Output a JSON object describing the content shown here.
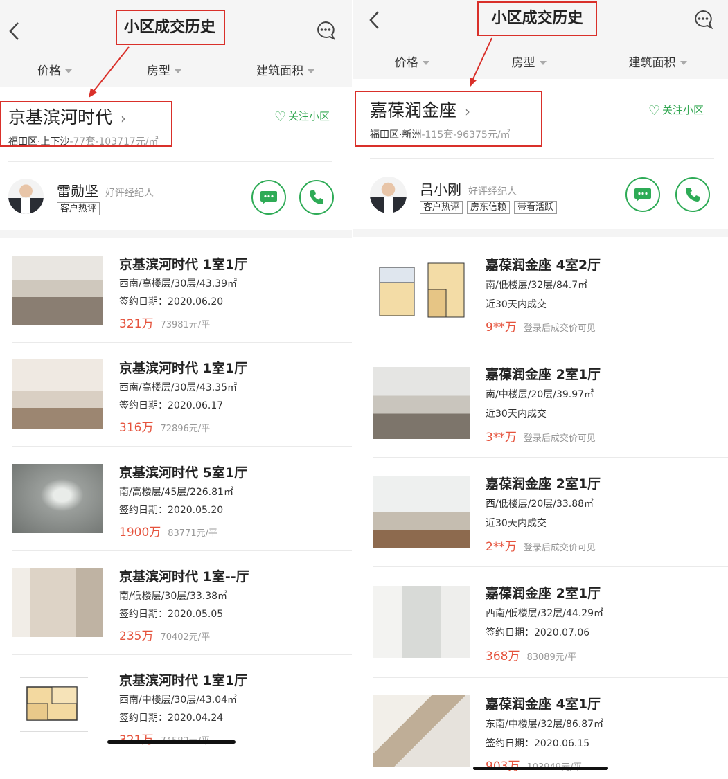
{
  "colors": {
    "accent_green": "#2eab56",
    "price_red": "#e5533d",
    "annotation_red": "#d9302a"
  },
  "panels": [
    {
      "header": {
        "title": "小区成交历史",
        "back_icon": "chevron-left-icon",
        "message_icon": "chat-bubble-icon"
      },
      "filters": [
        "价格",
        "房型",
        "建筑面积"
      ],
      "community": {
        "name": "京基滨河时代",
        "district": "福田区·上下沙",
        "stats": "-77套-103717元/㎡",
        "follow_label": "关注小区"
      },
      "agent": {
        "name": "雷勋坚",
        "role": "好评经纪人",
        "tags": [
          "客户热评"
        ]
      },
      "listings": [
        {
          "title": "京基滨河时代 1室1厅",
          "spec": "西南/高楼层/30层/43.39㎡",
          "date": "签约日期：2020.06.20",
          "price": "321万",
          "unit_price": "73981元/平"
        },
        {
          "title": "京基滨河时代 1室1厅",
          "spec": "西南/高楼层/30层/43.35㎡",
          "date": "签约日期：2020.06.17",
          "price": "316万",
          "unit_price": "72896元/平"
        },
        {
          "title": "京基滨河时代 5室1厅",
          "spec": "南/高楼层/45层/226.81㎡",
          "date": "签约日期：2020.05.20",
          "price": "1900万",
          "unit_price": "83771元/平"
        },
        {
          "title": "京基滨河时代 1室--厅",
          "spec": "南/低楼层/30层/33.38㎡",
          "date": "签约日期：2020.05.05",
          "price": "235万",
          "unit_price": "70402元/平"
        },
        {
          "title": "京基滨河时代 1室1厅",
          "spec": "西南/中楼层/30层/43.04㎡",
          "date": "签约日期：2020.04.24",
          "price": "321万",
          "unit_price": "74582元/平"
        }
      ]
    },
    {
      "header": {
        "title": "小区成交历史",
        "back_icon": "chevron-left-icon",
        "message_icon": "chat-bubble-icon"
      },
      "filters": [
        "价格",
        "房型",
        "建筑面积"
      ],
      "community": {
        "name": "嘉葆润金座",
        "district": "福田区·新洲",
        "stats": "-115套-96375元/㎡",
        "follow_label": "关注小区"
      },
      "agent": {
        "name": "吕小刚",
        "role": "好评经纪人",
        "tags": [
          "客户热评",
          "房东信赖",
          "带看活跃"
        ]
      },
      "listings": [
        {
          "title": "嘉葆润金座 4室2厅",
          "spec": "南/低楼层/32层/84.7㎡",
          "date": "近30天内成交",
          "price": "9**万",
          "unit_price": "登录后成交价可见"
        },
        {
          "title": "嘉葆润金座 2室1厅",
          "spec": "南/中楼层/20层/39.97㎡",
          "date": "近30天内成交",
          "price": "3**万",
          "unit_price": "登录后成交价可见"
        },
        {
          "title": "嘉葆润金座 2室1厅",
          "spec": "西/低楼层/20层/33.88㎡",
          "date": "近30天内成交",
          "price": "2**万",
          "unit_price": "登录后成交价可见"
        },
        {
          "title": "嘉葆润金座 2室1厅",
          "spec": "西南/低楼层/32层/44.29㎡",
          "date": "签约日期：2020.07.06",
          "price": "368万",
          "unit_price": "83089元/平"
        },
        {
          "title": "嘉葆润金座 4室1厅",
          "spec": "东南/中楼层/32层/86.87㎡",
          "date": "签约日期：2020.06.15",
          "price": "903万",
          "unit_price": "103949元/平"
        }
      ]
    }
  ]
}
